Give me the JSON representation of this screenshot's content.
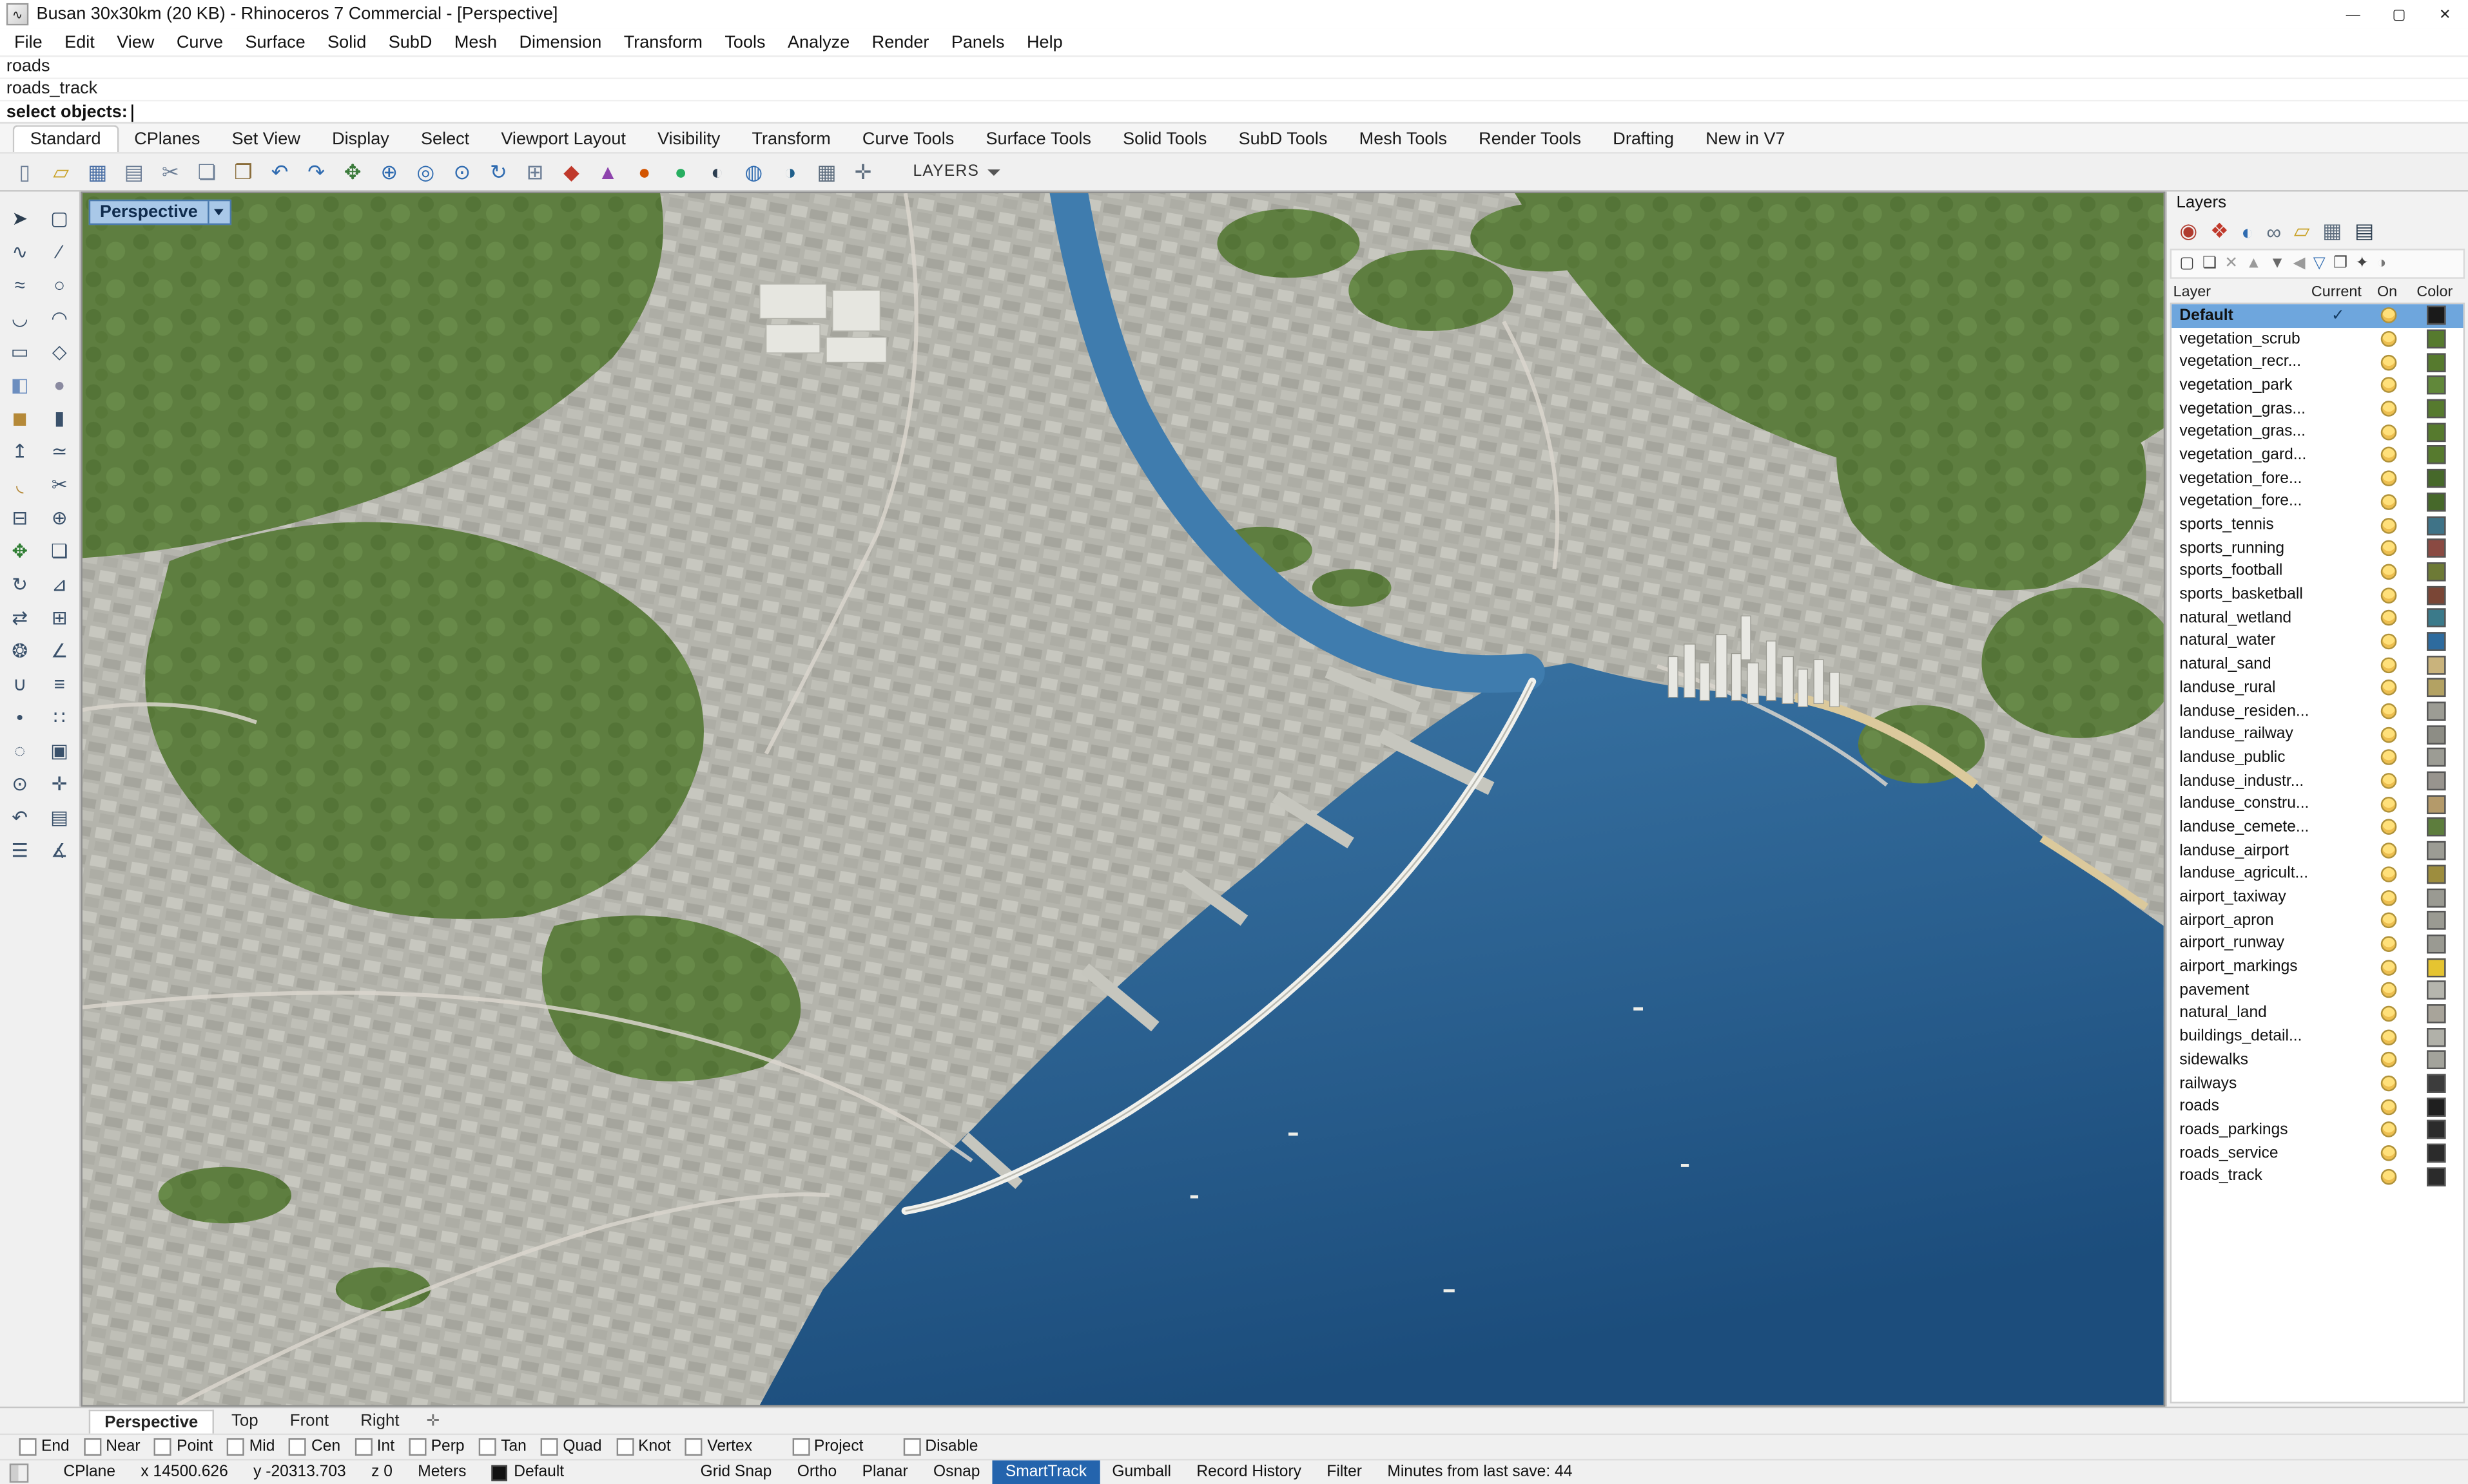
{
  "window": {
    "title": "Busan 30x30km (20 KB) - Rhinoceros 7 Commercial - [Perspective]",
    "controls": [
      {
        "name": "minimize-button",
        "glyph": "—"
      },
      {
        "name": "maximize-button",
        "glyph": "▢"
      },
      {
        "name": "close-button",
        "glyph": "✕"
      }
    ]
  },
  "menu": {
    "items": [
      "File",
      "Edit",
      "View",
      "Curve",
      "Surface",
      "Solid",
      "SubD",
      "Mesh",
      "Dimension",
      "Transform",
      "Tools",
      "Analyze",
      "Render",
      "Panels",
      "Help"
    ]
  },
  "command": {
    "history": [
      "roads",
      "roads_track"
    ],
    "prompt": "select objects:"
  },
  "toolbar_tabs": [
    {
      "label": "Standard",
      "active": true
    },
    {
      "label": "CPlanes"
    },
    {
      "label": "Set View"
    },
    {
      "label": "Display"
    },
    {
      "label": "Select"
    },
    {
      "label": "Viewport Layout"
    },
    {
      "label": "Visibility"
    },
    {
      "label": "Transform"
    },
    {
      "label": "Curve Tools"
    },
    {
      "label": "Surface Tools"
    },
    {
      "label": "Solid Tools"
    },
    {
      "label": "SubD Tools"
    },
    {
      "label": "Mesh Tools"
    },
    {
      "label": "Render Tools"
    },
    {
      "label": "Drafting"
    },
    {
      "label": "New in V7"
    }
  ],
  "toolbar": {
    "layers_label": "LAYERS",
    "icons": [
      {
        "name": "new-file-icon",
        "glyph": "▯",
        "color": "#6b7d95"
      },
      {
        "name": "open-file-icon",
        "glyph": "▱",
        "color": "#c9a227"
      },
      {
        "name": "save-icon",
        "glyph": "▦",
        "color": "#4a6fa5"
      },
      {
        "name": "print-icon",
        "glyph": "▤",
        "color": "#6b7d95"
      },
      {
        "name": "cut-icon",
        "glyph": "✂",
        "color": "#6b7d95"
      },
      {
        "name": "copy-icon",
        "glyph": "❏",
        "color": "#6b7d95"
      },
      {
        "name": "paste-icon",
        "glyph": "❐",
        "color": "#8a6d3b"
      },
      {
        "name": "undo-icon",
        "glyph": "↶",
        "color": "#2f6bb0"
      },
      {
        "name": "redo-icon",
        "glyph": "↷",
        "color": "#2f6bb0"
      },
      {
        "name": "pan-view-icon",
        "glyph": "✥",
        "color": "#3a7a3a"
      },
      {
        "name": "zoom-window-icon",
        "glyph": "⊕",
        "color": "#2f6bb0"
      },
      {
        "name": "zoom-extents-icon",
        "glyph": "◎",
        "color": "#2f6bb0"
      },
      {
        "name": "zoom-selected-icon",
        "glyph": "⊙",
        "color": "#2f6bb0"
      },
      {
        "name": "rotate-view-icon",
        "glyph": "↻",
        "color": "#2f6bb0"
      },
      {
        "name": "grid-toggle-icon",
        "glyph": "⊞",
        "color": "#6b7d95"
      },
      {
        "name": "render-vehicle-icon",
        "glyph": "◆",
        "color": "#c0392b"
      },
      {
        "name": "spotlight-icon",
        "glyph": "▲",
        "color": "#8e44ad"
      },
      {
        "name": "material-sphere-icon",
        "glyph": "●",
        "color": "#d35400"
      },
      {
        "name": "shaded-sphere-icon",
        "glyph": "●",
        "color": "#27ae60"
      },
      {
        "name": "render-sphere-icon",
        "glyph": "◐",
        "color": "#2c3e50"
      },
      {
        "name": "globe-icon",
        "glyph": "◍",
        "color": "#2f6bb0"
      },
      {
        "name": "display-mode-icon",
        "glyph": "◑",
        "color": "#1f5f8b"
      },
      {
        "name": "grid-pointer-icon",
        "glyph": "▦",
        "color": "#5d6d7e"
      },
      {
        "name": "snap-settings-icon",
        "glyph": "✛",
        "color": "#5d6d7e"
      }
    ]
  },
  "palette": {
    "icons": [
      {
        "name": "select-pointer-icon",
        "glyph": "➤",
        "color": "#2c3e50"
      },
      {
        "name": "lasso-select-icon",
        "glyph": "▢"
      },
      {
        "name": "curve-icon",
        "glyph": "∿"
      },
      {
        "name": "line-icon",
        "glyph": "∕"
      },
      {
        "name": "freeform-curve-icon",
        "glyph": "≈"
      },
      {
        "name": "circle-icon",
        "glyph": "○"
      },
      {
        "name": "arc-icon",
        "glyph": "◡"
      },
      {
        "name": "ellipse-icon",
        "glyph": "◠"
      },
      {
        "name": "rectangle-icon",
        "glyph": "▭"
      },
      {
        "name": "polygon-icon",
        "glyph": "◇"
      },
      {
        "name": "surface-icon",
        "glyph": "◧",
        "color": "#6c8ebf"
      },
      {
        "name": "sphere-icon",
        "glyph": "●",
        "color": "#8a8aa0"
      },
      {
        "name": "box-icon",
        "glyph": "◼",
        "color": "#b58938"
      },
      {
        "name": "cylinder-icon",
        "glyph": "▮"
      },
      {
        "name": "extrude-icon",
        "glyph": "↥"
      },
      {
        "name": "loft-icon",
        "glyph": "≃"
      },
      {
        "name": "fillet-icon",
        "glyph": "◟",
        "color": "#b58938"
      },
      {
        "name": "trim-icon",
        "glyph": "✂"
      },
      {
        "name": "split-icon",
        "glyph": "⊟"
      },
      {
        "name": "join-icon",
        "glyph": "⊕"
      },
      {
        "name": "move-icon",
        "glyph": "✥",
        "color": "#2e7d32"
      },
      {
        "name": "copy-icon",
        "glyph": "❏"
      },
      {
        "name": "rotate-icon",
        "glyph": "↻"
      },
      {
        "name": "scale-icon",
        "glyph": "⊿"
      },
      {
        "name": "mirror-icon",
        "glyph": "⇄"
      },
      {
        "name": "array-icon",
        "glyph": "⊞"
      },
      {
        "name": "polar-array-icon",
        "glyph": "❂"
      },
      {
        "name": "orient-icon",
        "glyph": "∠"
      },
      {
        "name": "boolean-union-icon",
        "glyph": "∪"
      },
      {
        "name": "offset-icon",
        "glyph": "≡"
      },
      {
        "name": "point-icon",
        "glyph": "•"
      },
      {
        "name": "points-on-icon",
        "glyph": "∷"
      },
      {
        "name": "hide-object-icon",
        "glyph": "◌"
      },
      {
        "name": "lock-object-icon",
        "glyph": "▣"
      },
      {
        "name": "zoom-icon",
        "glyph": "⊙"
      },
      {
        "name": "pan-icon",
        "glyph": "✛"
      },
      {
        "name": "undo-view-icon",
        "glyph": "↶"
      },
      {
        "name": "layer-icon",
        "glyph": "▤"
      },
      {
        "name": "properties-icon",
        "glyph": "☰"
      },
      {
        "name": "measure-icon",
        "glyph": "∡"
      }
    ]
  },
  "viewport": {
    "label": "Perspective"
  },
  "viewport_tabs": {
    "items": [
      {
        "label": "Perspective",
        "active": true
      },
      {
        "label": "Top"
      },
      {
        "label": "Front"
      },
      {
        "label": "Right"
      }
    ],
    "add_glyph": "✛"
  },
  "layers_panel": {
    "title": "Layers",
    "columns": [
      "Layer",
      "Current",
      "On",
      "Color"
    ],
    "tabs": [
      {
        "name": "panel-tab-properties",
        "glyph": "◉",
        "color": "#b03a2e"
      },
      {
        "name": "panel-tab-materials",
        "glyph": "❖",
        "color": "#c0392b"
      },
      {
        "name": "panel-tab-display",
        "glyph": "◐",
        "color": "#2f6bb0"
      },
      {
        "name": "panel-tab-links",
        "glyph": "∞",
        "color": "#5d6d7e"
      },
      {
        "name": "panel-tab-libraries",
        "glyph": "▱",
        "color": "#c9a227"
      },
      {
        "name": "panel-tab-rendering",
        "glyph": "▦",
        "color": "#5d6d7e"
      },
      {
        "name": "panel-tab-layers",
        "glyph": "▤",
        "color": "#2c3e50"
      }
    ],
    "tools": [
      {
        "name": "new-layer-icon",
        "glyph": "▢",
        "color": "#444444"
      },
      {
        "name": "new-sublayer-icon",
        "glyph": "❏",
        "color": "#444444"
      },
      {
        "name": "delete-layer-icon",
        "glyph": "✕",
        "color": "#9a9a9a"
      },
      {
        "name": "move-layer-up-icon",
        "glyph": "▲",
        "color": "#9a9a9a"
      },
      {
        "name": "move-layer-down-icon",
        "glyph": "▼",
        "color": "#6a6a6a"
      },
      {
        "name": "collapse-all-icon",
        "glyph": "◀",
        "color": "#9a9a9a"
      },
      {
        "name": "filter-layers-icon",
        "glyph": "▽",
        "color": "#2f6bb0"
      },
      {
        "name": "match-layer-icon",
        "glyph": "❐",
        "color": "#444444"
      },
      {
        "name": "layer-settings-icon",
        "glyph": "✦",
        "color": "#444444"
      },
      {
        "name": "layer-state-icon",
        "glyph": "◑",
        "color": "#777777"
      }
    ],
    "layers": [
      {
        "name": "Default",
        "current": true,
        "selected": true,
        "color": "#1a1a1a"
      },
      {
        "name": "vegetation_scrub",
        "color": "#567a2e"
      },
      {
        "name": "vegetation_recr...",
        "color": "#567a2e"
      },
      {
        "name": "vegetation_park",
        "color": "#61883a"
      },
      {
        "name": "vegetation_gras...",
        "color": "#567a2e"
      },
      {
        "name": "vegetation_gras...",
        "color": "#567a2e"
      },
      {
        "name": "vegetation_gard...",
        "color": "#567a2e"
      },
      {
        "name": "vegetation_fore...",
        "color": "#46682a"
      },
      {
        "name": "vegetation_fore...",
        "color": "#46682a"
      },
      {
        "name": "sports_tennis",
        "color": "#3f7387"
      },
      {
        "name": "sports_running",
        "color": "#8a4a42"
      },
      {
        "name": "sports_football",
        "color": "#6d7a36"
      },
      {
        "name": "sports_basketball",
        "color": "#7a4636"
      },
      {
        "name": "natural_wetland",
        "color": "#3b7a8a"
      },
      {
        "name": "natural_water",
        "color": "#2e6b9e"
      },
      {
        "name": "natural_sand",
        "color": "#c9b37c"
      },
      {
        "name": "landuse_rural",
        "color": "#b3a263"
      },
      {
        "name": "landuse_residen...",
        "color": "#9c9c94"
      },
      {
        "name": "landuse_railway",
        "color": "#8d8d85"
      },
      {
        "name": "landuse_public",
        "color": "#9c9c94"
      },
      {
        "name": "landuse_industr...",
        "color": "#98948e"
      },
      {
        "name": "landuse_constru...",
        "color": "#b49a6a"
      },
      {
        "name": "landuse_cemete...",
        "color": "#5d7d3d"
      },
      {
        "name": "landuse_airport",
        "color": "#9c9c94"
      },
      {
        "name": "landuse_agricult...",
        "color": "#9d8d3e"
      },
      {
        "name": "airport_taxiway",
        "color": "#9a9a92"
      },
      {
        "name": "airport_apron",
        "color": "#9a9a92"
      },
      {
        "name": "airport_runway",
        "color": "#9a9a92"
      },
      {
        "name": "airport_markings",
        "color": "#e5c431"
      },
      {
        "name": "pavement",
        "color": "#b5b5ad"
      },
      {
        "name": "natural_land",
        "color": "#a8a49a"
      },
      {
        "name": "buildings_detail...",
        "color": "#b1b1a9"
      },
      {
        "name": "sidewalks",
        "color": "#a3a39b"
      },
      {
        "name": "railways",
        "color": "#3c3c3c"
      },
      {
        "name": "roads",
        "color": "#1f1f1f"
      },
      {
        "name": "roads_parkings",
        "color": "#2b2b2b"
      },
      {
        "name": "roads_service",
        "color": "#2b2b2b"
      },
      {
        "name": "roads_track",
        "color": "#2b2b2b"
      }
    ]
  },
  "osnap": {
    "items": [
      {
        "label": "End"
      },
      {
        "label": "Near"
      },
      {
        "label": "Point"
      },
      {
        "label": "Mid"
      },
      {
        "label": "Cen"
      },
      {
        "label": "Int"
      },
      {
        "label": "Perp"
      },
      {
        "label": "Tan"
      },
      {
        "label": "Quad"
      },
      {
        "label": "Knot"
      },
      {
        "label": "Vertex"
      },
      {
        "label": "Project",
        "gap": true
      },
      {
        "label": "Disable",
        "gap": true
      }
    ]
  },
  "status": {
    "items": [
      {
        "label": "CPlane",
        "ia": true
      },
      {
        "label": "x 14500.626",
        "ia": false
      },
      {
        "label": "y -20313.703",
        "ia": false
      },
      {
        "label": "z 0",
        "ia": false
      },
      {
        "label": "Meters",
        "ia": true
      },
      {
        "label": "Default",
        "swatch": "#111111",
        "ia": true
      },
      {
        "label": "Grid Snap",
        "group": true,
        "ia": true
      },
      {
        "label": "Ortho",
        "ia": true
      },
      {
        "label": "Planar",
        "ia": true
      },
      {
        "label": "Osnap",
        "ia": true
      },
      {
        "label": "SmartTrack",
        "active": true,
        "ia": true
      },
      {
        "label": "Gumball",
        "ia": true
      },
      {
        "label": "Record History",
        "ia": true
      },
      {
        "label": "Filter",
        "ia": true
      },
      {
        "label": "Minutes from last save: 44",
        "ia": false
      }
    ]
  }
}
